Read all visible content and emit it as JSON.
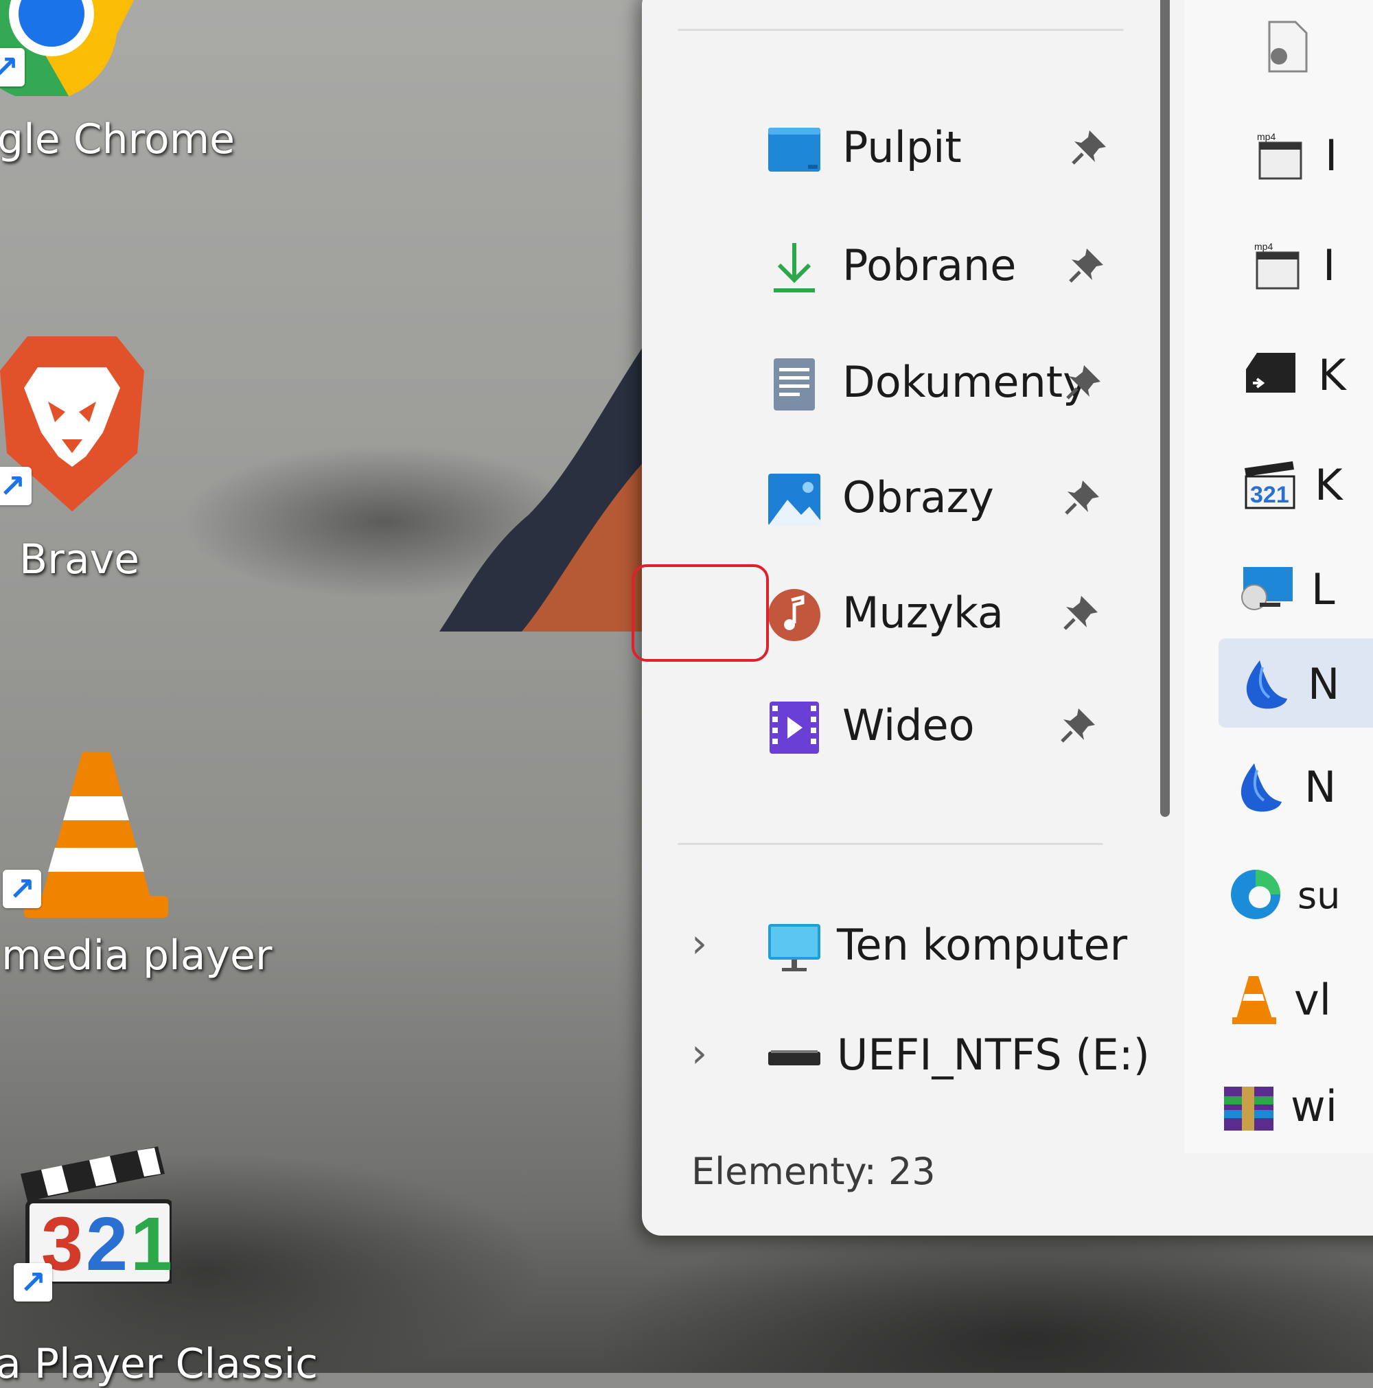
{
  "desktop": {
    "icons": [
      {
        "label": "gle Chrome",
        "icon": "chrome-icon"
      },
      {
        "label": "Brave",
        "icon": "brave-icon"
      },
      {
        "label": "media player",
        "icon": "vlc-icon"
      },
      {
        "label": "a Player Classic",
        "icon": "mpc-hc-icon"
      }
    ]
  },
  "explorer": {
    "quick_access": [
      {
        "label": "Pulpit",
        "icon": "desktop-folder-icon"
      },
      {
        "label": "Pobrane",
        "icon": "download-arrow-icon"
      },
      {
        "label": "Dokumenty",
        "icon": "documents-icon"
      },
      {
        "label": "Obrazy",
        "icon": "pictures-icon"
      },
      {
        "label": "Muzyka",
        "icon": "music-icon"
      },
      {
        "label": "Wideo",
        "icon": "video-icon"
      }
    ],
    "drives": [
      {
        "label": "Ten komputer",
        "icon": "monitor-icon"
      },
      {
        "label": "UEFI_NTFS (E:)",
        "icon": "drive-icon"
      }
    ],
    "status": "Elementy: 23",
    "files": [
      {
        "name": "",
        "icon": "settings-file-icon"
      },
      {
        "name": "I",
        "icon": "mp4-file-icon"
      },
      {
        "name": "I",
        "icon": "mp4-file-icon"
      },
      {
        "name": "K",
        "icon": "app-shortcut-icon"
      },
      {
        "name": "K",
        "icon": "mpc-file-icon"
      },
      {
        "name": "L",
        "icon": "display-disc-icon"
      },
      {
        "name": "N",
        "icon": "blue-drop-icon"
      },
      {
        "name": "N",
        "icon": "blue-drop-icon"
      },
      {
        "name": "su",
        "icon": "edge-icon"
      },
      {
        "name": "vl",
        "icon": "vlc-icon"
      },
      {
        "name": "wi",
        "icon": "winrar-icon"
      }
    ]
  },
  "colors": {
    "highlight": "#e0202a",
    "selection": "#dde6f2",
    "accent": "#1a73e8"
  }
}
